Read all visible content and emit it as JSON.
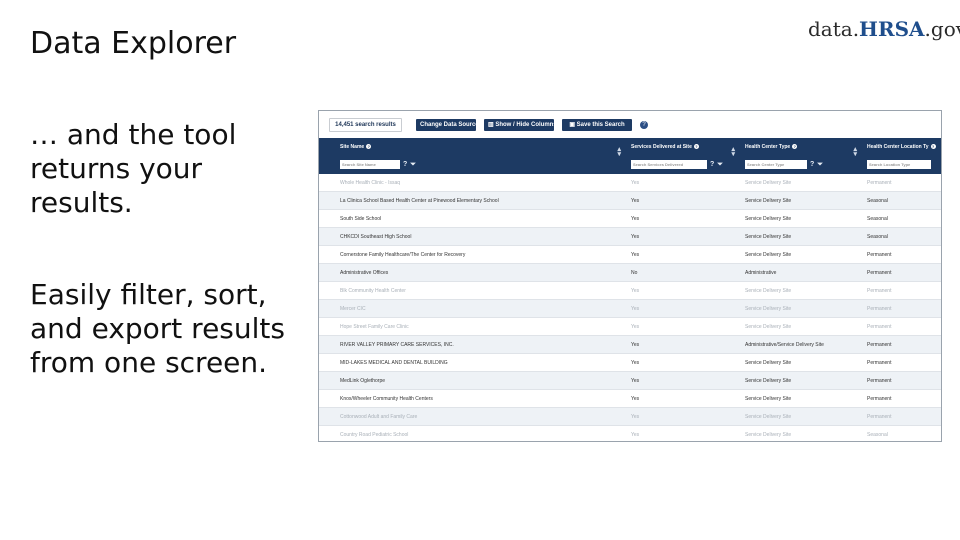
{
  "slide": {
    "title": "Data Explorer",
    "logo": {
      "prefix": "data.",
      "brand": "HRSA",
      "suffix": ".gov"
    },
    "caption1": "… and the tool returns your results.",
    "caption2": "Easily filter, sort, and export results from one screen."
  },
  "toolbar": {
    "results_count": "14,451 search results",
    "change_sources_label": "Change Data Sources",
    "show_hide_label": "Show / Hide Columns",
    "save_search_label": "Save this Search"
  },
  "table": {
    "columns": [
      {
        "label": "Site Name",
        "filter_placeholder": "Search Site Name"
      },
      {
        "label": "Services Delivered at Site",
        "filter_placeholder": "Search Services Delivered"
      },
      {
        "label": "Health Center Type",
        "filter_placeholder": "Search Center Type"
      },
      {
        "label": "Health Center Location Ty",
        "filter_placeholder": "Search Location Type"
      }
    ],
    "rows": [
      {
        "name": "Whole Health Clinic - Issaq",
        "services": "Yes",
        "type": "Service Delivery Site",
        "location": "Permanent",
        "faded": true
      },
      {
        "name": "La Clinica School Based Health Center at Pinewood Elementary School",
        "services": "Yes",
        "type": "Service Delivery Site",
        "location": "Seasonal"
      },
      {
        "name": "South Side School",
        "services": "Yes",
        "type": "Service Delivery Site",
        "location": "Seasonal"
      },
      {
        "name": "CHKCDI Southeast High School",
        "services": "Yes",
        "type": "Service Delivery Site",
        "location": "Seasonal"
      },
      {
        "name": "Cornerstone Family Healthcare/The Center for Recovery",
        "services": "Yes",
        "type": "Service Delivery Site",
        "location": "Permanent"
      },
      {
        "name": "Administrative Offices",
        "services": "No",
        "type": "Administrative",
        "location": "Permanent"
      },
      {
        "name": "Blk Community Health Center",
        "services": "Yes",
        "type": "Service Delivery Site",
        "location": "Permanent",
        "faded": true
      },
      {
        "name": "Mercer CIC",
        "services": "Yes",
        "type": "Service Delivery Site",
        "location": "Permanent",
        "faded": true
      },
      {
        "name": "Hope Street Family Care Clinic",
        "services": "Yes",
        "type": "Service Delivery Site",
        "location": "Permanent",
        "faded": true
      },
      {
        "name": "RIVER VALLEY PRIMARY CARE SERVICES, INC.",
        "services": "Yes",
        "type": "Administrative/Service Delivery Site",
        "location": "Permanent"
      },
      {
        "name": "MID-LAKES MEDICAL AND DENTAL BUILDING",
        "services": "Yes",
        "type": "Service Delivery Site",
        "location": "Permanent"
      },
      {
        "name": "MedLink Oglethorpe",
        "services": "Yes",
        "type": "Service Delivery Site",
        "location": "Permanent"
      },
      {
        "name": "Knox/Wheeler Community Health Centers",
        "services": "Yes",
        "type": "Service Delivery Site",
        "location": "Permanent"
      },
      {
        "name": "Cottonwood Adult and Family Care",
        "services": "Yes",
        "type": "Service Delivery Site",
        "location": "Permanent",
        "faded": true
      },
      {
        "name": "Country Road Pediatric School",
        "services": "Yes",
        "type": "Service Delivery Site",
        "location": "Seasonal",
        "faded": true
      }
    ]
  }
}
